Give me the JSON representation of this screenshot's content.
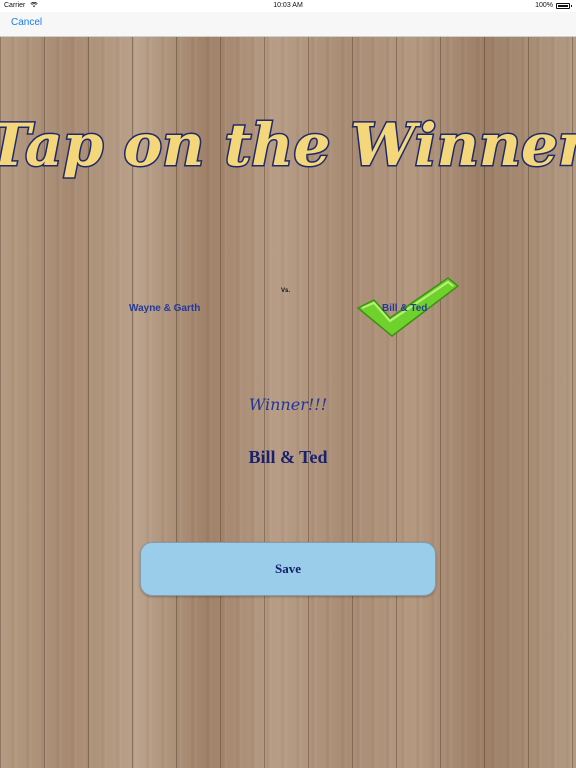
{
  "status_bar": {
    "carrier": "Carrier",
    "time": "10:03 AM",
    "battery": "100%"
  },
  "nav": {
    "cancel_label": "Cancel"
  },
  "title": "Tap on the Winner",
  "matchup": {
    "left_team": "Wayne & Garth",
    "vs": "Vs.",
    "right_team": "Bill & Ted",
    "selected": "right"
  },
  "result": {
    "label": "Winner!!!",
    "winner_name": "Bill & Ted"
  },
  "save_label": "Save",
  "colors": {
    "title_fill": "#f4d77b",
    "title_outline": "#1f2a6b",
    "team_text": "#243a9a",
    "check_green": "#6fd12b",
    "save_bg": "#99cde9",
    "link_blue": "#1a7cf4"
  }
}
